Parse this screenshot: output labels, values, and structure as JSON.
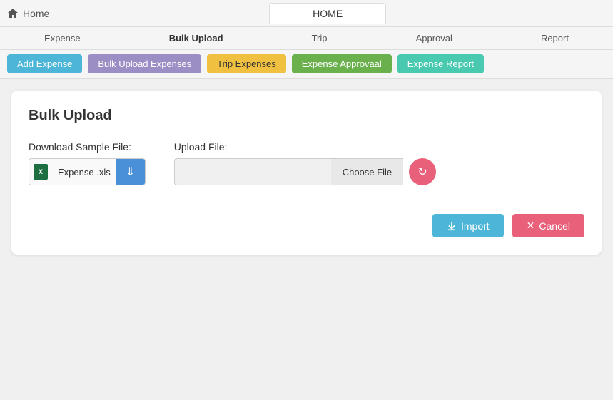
{
  "topbar": {
    "home_label": "Home",
    "home_tab": "HOME"
  },
  "nav": {
    "items": [
      {
        "label": "Expense",
        "active": false
      },
      {
        "label": "Bulk Upload",
        "active": true
      },
      {
        "label": "Trip",
        "active": false
      },
      {
        "label": "Approval",
        "active": false
      },
      {
        "label": "Report",
        "active": false
      }
    ]
  },
  "action_buttons": [
    {
      "label": "Add Expense",
      "style": "blue"
    },
    {
      "label": "Bulk Upload Expenses",
      "style": "purple"
    },
    {
      "label": "Trip Expenses",
      "style": "yellow"
    },
    {
      "label": "Expense Approvaal",
      "style": "green"
    },
    {
      "label": "Expense Report",
      "style": "teal"
    }
  ],
  "card": {
    "title": "Bulk Upload",
    "download_label": "Download Sample File:",
    "file_name": "Expense .xls",
    "upload_label": "Upload File:",
    "upload_placeholder": "",
    "choose_file_label": "Choose File"
  },
  "footer": {
    "import_label": "Import",
    "cancel_label": "Cancel"
  }
}
